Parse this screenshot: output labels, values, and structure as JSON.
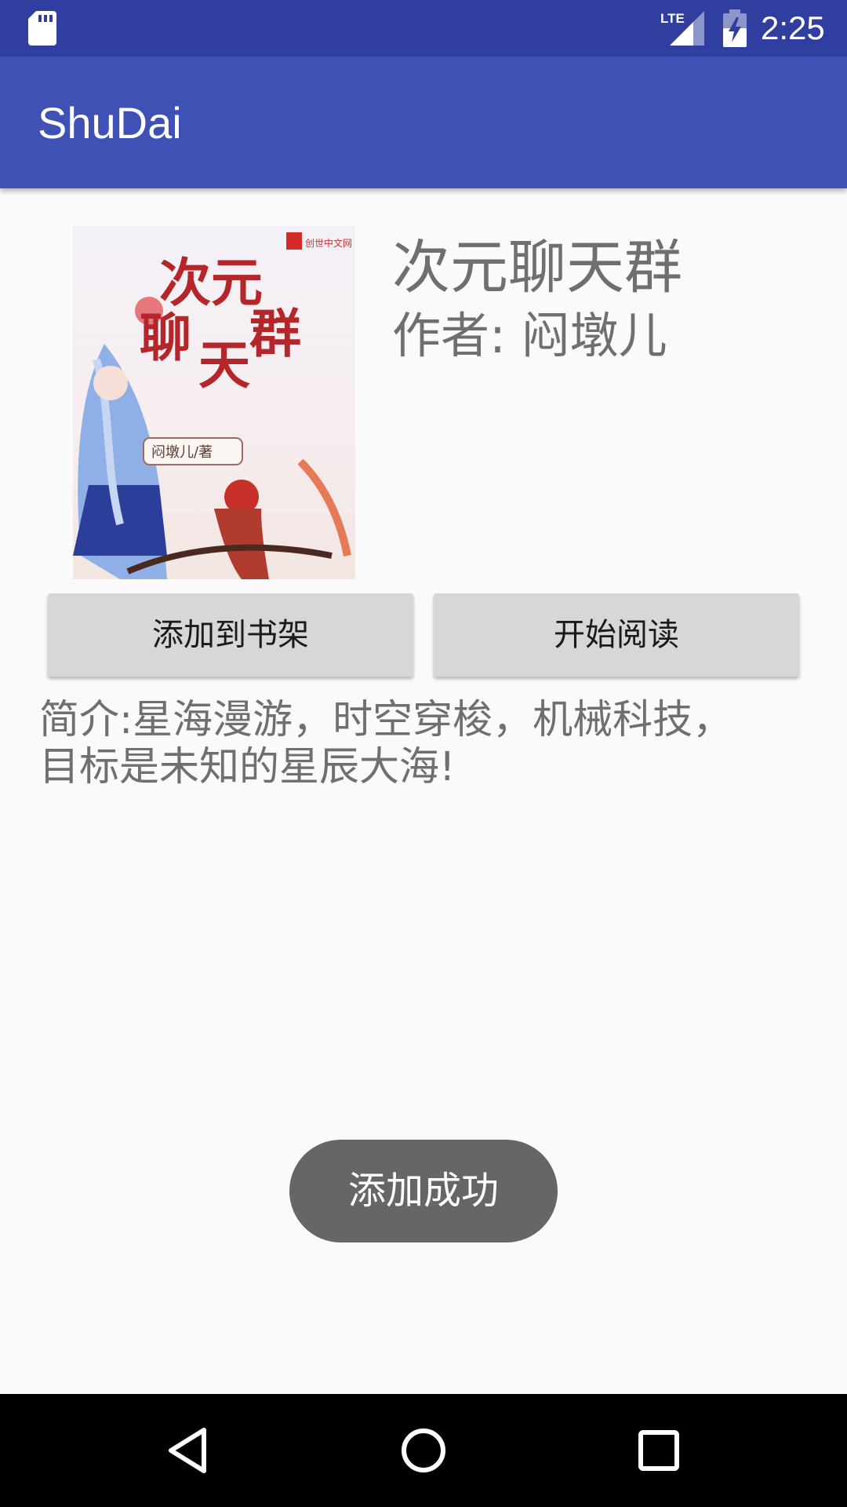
{
  "status_bar": {
    "time": "2:25",
    "network_label": "LTE",
    "icons": [
      "sd-card-icon",
      "lte-signal-icon",
      "battery-charging-icon"
    ]
  },
  "app_bar": {
    "title": "ShuDai"
  },
  "book": {
    "title": "次元聊天群",
    "author_label": "作者:  闷墩儿",
    "cover": {
      "title_text": "次元聊天群",
      "author_text": "闷墩儿/著",
      "publisher_text": "创世中文网"
    }
  },
  "actions": {
    "add_to_shelf_label": "添加到书架",
    "start_reading_label": "开始阅读"
  },
  "intro": {
    "line1": "简介:星海漫游，时空穿梭，机械科技，",
    "line2": "目标是未知的星辰大海!"
  },
  "toast": {
    "message": "添加成功"
  },
  "nav_bar": {
    "icons": [
      "back-icon",
      "home-icon",
      "recents-icon"
    ]
  },
  "colors": {
    "status_bar": "#303f9f",
    "app_bar": "#3f51b5",
    "background": "#fafafa",
    "button": "#d6d7d7",
    "toast": "#666666",
    "text_secondary": "#6f6f6f"
  }
}
